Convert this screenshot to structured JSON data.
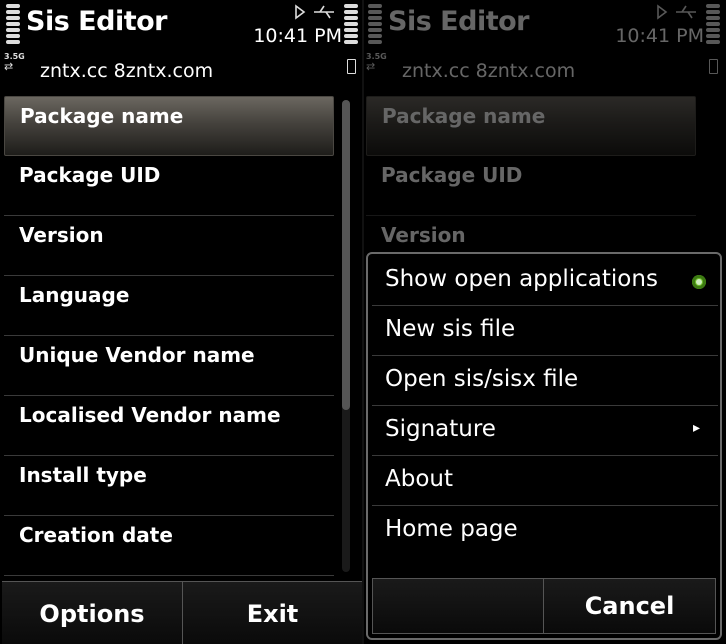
{
  "app": {
    "title": "Sis Editor"
  },
  "status": {
    "time": "10:41 PM",
    "network": "3.5G",
    "subtitle": "zntx.cc  8zntx.com"
  },
  "list": {
    "items": [
      {
        "label": "Package name",
        "selected": true
      },
      {
        "label": "Package UID"
      },
      {
        "label": "Version"
      },
      {
        "label": "Language"
      },
      {
        "label": "Unique Vendor name"
      },
      {
        "label": "Localised Vendor name"
      },
      {
        "label": "Install type"
      },
      {
        "label": "Creation date"
      }
    ]
  },
  "softkeys": {
    "left": "Options",
    "right": "Exit"
  },
  "menu": {
    "items": [
      {
        "label": "Show open applications",
        "indicator": "green-dot-icon"
      },
      {
        "label": "New sis file"
      },
      {
        "label": "Open sis/sisx file"
      },
      {
        "label": "Signature",
        "indicator": "submenu-arrow-icon"
      },
      {
        "label": "About"
      },
      {
        "label": "Home page"
      }
    ],
    "cancel": "Cancel"
  },
  "colors": {
    "accent_green": "#6fbf2a",
    "background": "#000000",
    "text": "#ffffff"
  }
}
